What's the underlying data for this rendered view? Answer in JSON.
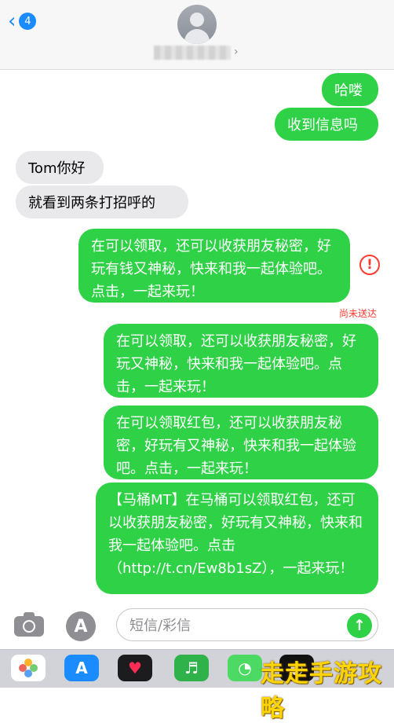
{
  "header": {
    "back_count": "4",
    "back_icon": "chevron-left-icon",
    "avatar_icon": "person-avatar-icon",
    "contact_chevron": "›"
  },
  "messages": [
    {
      "side": "out",
      "text": "哈喽"
    },
    {
      "side": "out",
      "text": "收到信息吗"
    },
    {
      "side": "in",
      "text": "Tom你好"
    },
    {
      "side": "in",
      "text": "就看到两条打招呼的"
    },
    {
      "side": "out",
      "text": "在可以领取，还可以收获朋友秘密，好玩有钱又神秘，快来和我一起体验吧。点击，一起来玩！",
      "error": true
    },
    {
      "side": "out",
      "text": "在可以领取，还可以收获朋友秘密，好玩又神秘，快来和我一起体验吧。点击，一起来玩！"
    },
    {
      "side": "out",
      "text": "在可以领取红包，还可以收获朋友秘密，好玩有又神秘，快来和我一起体验吧。点击，一起来玩！"
    },
    {
      "side": "out",
      "text": "【马桶MT】在马桶可以领取红包，还可以收获朋友秘密，好玩有又神秘，快来和我一起体验吧。点击（http://t.cn/Ew8b1sZ），一起来玩！"
    }
  ],
  "error_mark": "!",
  "not_sent_label": "尚未送达",
  "input": {
    "placeholder": "短信/彩信",
    "camera_icon": "camera-icon",
    "appstore_icon": "app-store-icon",
    "send_icon": "send-arrow-icon",
    "send_glyph": "↑"
  },
  "dock": {
    "icons": [
      "photos-icon",
      "app-store-icon",
      "heart-app-icon",
      "music-app-icon",
      "green-app-icon",
      "black-app-icon"
    ]
  },
  "watermark": "走走手游攻略",
  "colors": {
    "bubble_out": "#2fd147",
    "bubble_in": "#e9e9eb",
    "accent": "#1a8cff",
    "error": "#ff3b30"
  }
}
